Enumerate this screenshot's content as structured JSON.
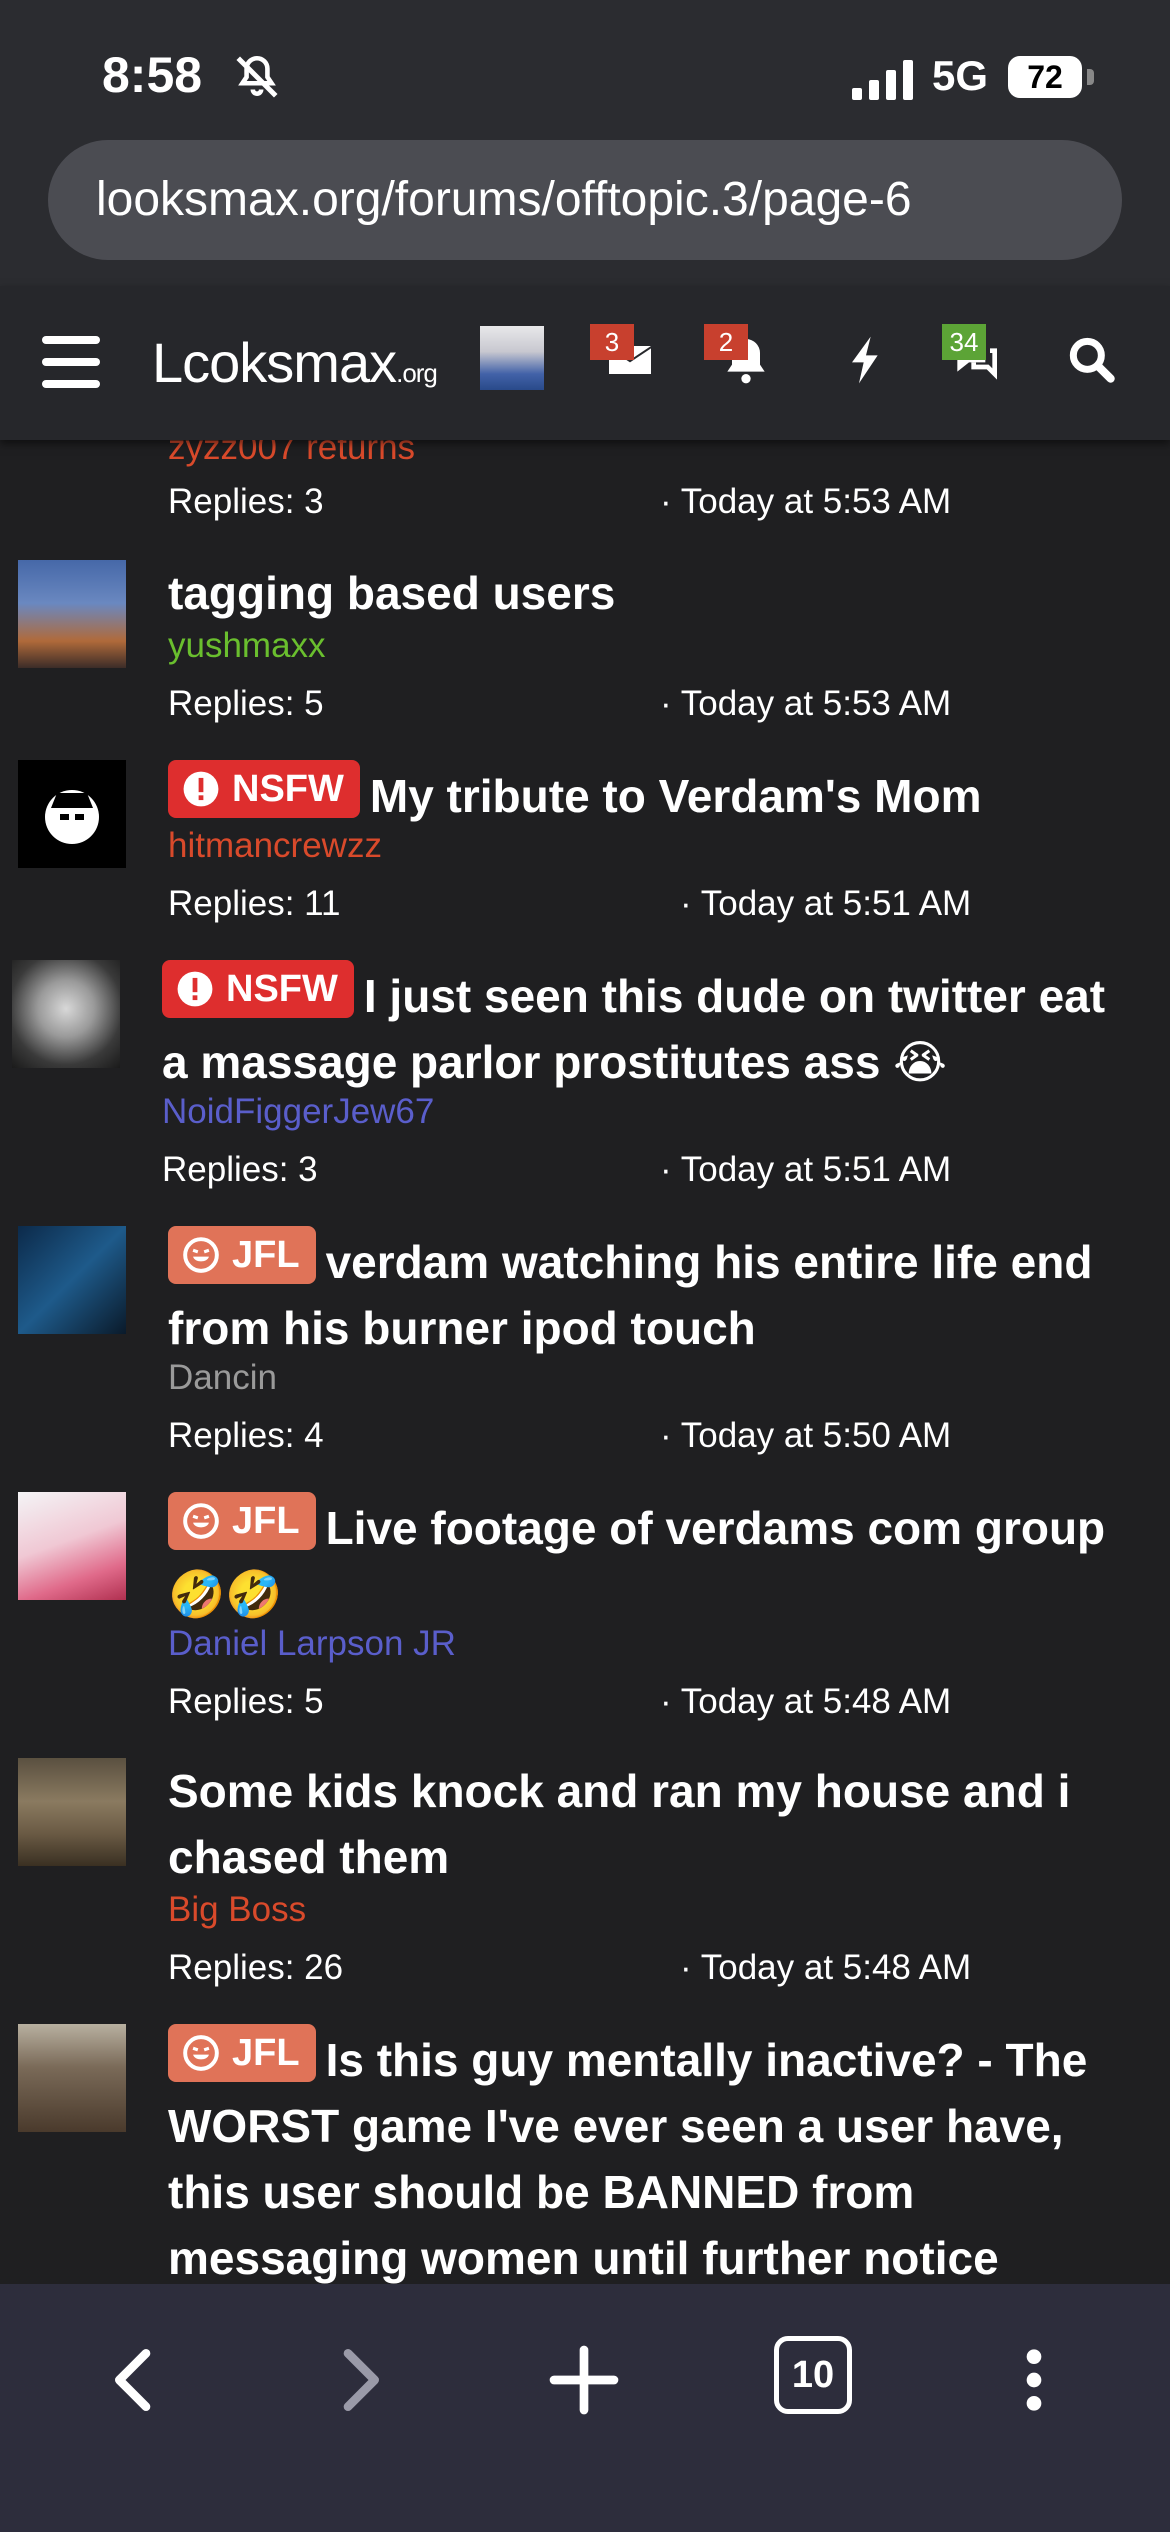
{
  "status_bar": {
    "time": "8:58",
    "network": "5G",
    "battery": "72"
  },
  "browser": {
    "url": "looksmax.org/forums/offtopic.3/page-6",
    "tab_count": "10"
  },
  "header": {
    "logo_main": "Lcoksmax",
    "logo_suffix": ".org",
    "badges": {
      "inbox": "3",
      "alerts": "2",
      "chat": "34"
    }
  },
  "threads": [
    {
      "title": "",
      "author": "zyzz007 returns",
      "author_color": "#d94a2b",
      "replies": "Replies: 3",
      "time": "· Today at 5:53 AM"
    },
    {
      "title": "tagging based users",
      "author": "yushmaxx",
      "author_color": "#6abf2e",
      "replies": "Replies: 5",
      "time": "· Today at 5:53 AM"
    },
    {
      "prefix": "NSFW",
      "title": "My tribute to Verdam's Mom",
      "author": "hitmancrewzz",
      "author_color": "#d94a2b",
      "replies": "Replies: 11",
      "time": "· Today at 5:51 AM"
    },
    {
      "prefix": "NSFW",
      "title": "I just seen this dude on twitter eat a massage parlor prostitutes ass 😭",
      "author": "NoidFiggerJew67",
      "author_color": "#5a5ecb",
      "replies": "Replies: 3",
      "time": "· Today at 5:51 AM"
    },
    {
      "prefix": "JFL",
      "title": "verdam watching his entire life end from his burner ipod touch",
      "author": "Dancin",
      "author_color": "#9a9a9a",
      "replies": "Replies: 4",
      "time": "· Today at 5:50 AM"
    },
    {
      "prefix": "JFL",
      "title": "Live footage of verdams com group 🤣🤣",
      "author": "Daniel Larpson JR",
      "author_color": "#5a5ecb",
      "replies": "Replies: 5",
      "time": "· Today at 5:48 AM"
    },
    {
      "title": "Some kids knock and ran my house and i chased them",
      "author": "Big Boss",
      "author_color": "#d94a2b",
      "replies": "Replies: 26",
      "time": "· Today at 5:48 AM"
    },
    {
      "prefix": "JFL",
      "title": "Is this guy mentally inactive? - The WORST game I've ever seen a user have, this user should be BANNED from messaging women until further notice",
      "author": "",
      "author_color": "#9a9a9a",
      "replies": "",
      "time": ""
    }
  ],
  "colors": {
    "background": "#1f1f21",
    "header": "#26272b",
    "nsfw": "#de2e2e",
    "jfl": "#e07358",
    "badge_red": "#c8402e",
    "badge_green": "#5ca436"
  }
}
